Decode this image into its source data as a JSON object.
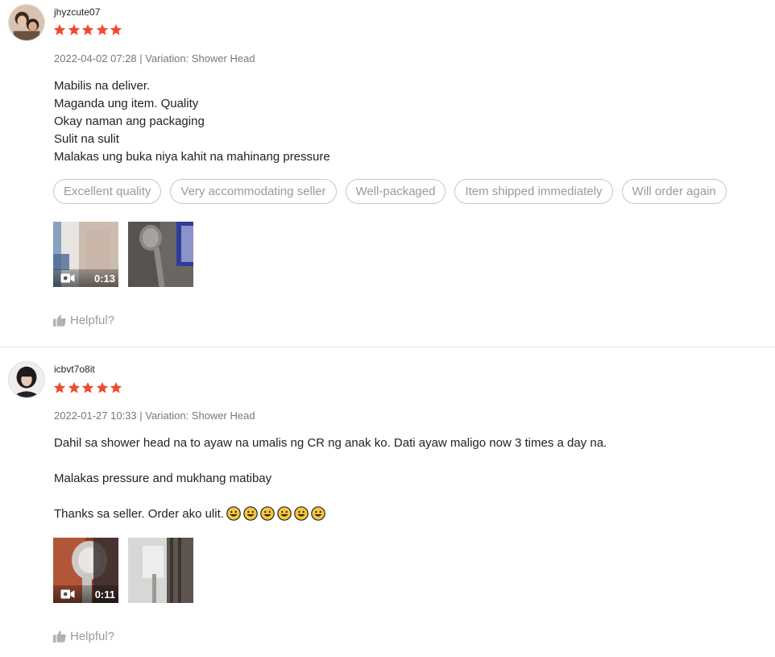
{
  "colors": {
    "star": "#ee4d2d",
    "tag_border": "#c7c7c7",
    "muted_text": "#9a9a9a",
    "divider": "#e8e8e8"
  },
  "reviews": [
    {
      "username": "jhyzcute07",
      "rating": 5,
      "meta": "2022-04-02 07:28 | Variation: Shower Head",
      "comment_lines": [
        "Mabilis na deliver.",
        "Maganda ung item. Quality",
        "Okay naman ang packaging",
        "Sulit na sulit",
        "Malakas ung buka niya kahit na mahinang pressure"
      ],
      "tags": [
        "Excellent quality",
        "Very accommodating seller",
        "Well-packaged",
        "Item shipped immediately",
        "Will order again"
      ],
      "media": [
        {
          "type": "video",
          "duration": "0:13",
          "icon": "video-camera-icon"
        },
        {
          "type": "image"
        }
      ],
      "helpful_label": "Helpful?",
      "helpful_icon": "thumbs-up-icon"
    },
    {
      "username": "icbvt7o8it",
      "rating": 5,
      "meta": "2022-01-27 10:33 | Variation: Shower Head",
      "comment_lines": [
        "Dahil sa shower head na to ayaw na umalis ng CR ng anak ko. Dati ayaw maligo now 3 times a day na.",
        "",
        "Malakas pressure and mukhang matibay",
        "",
        "Thanks sa seller. Order ako ulit."
      ],
      "emoji_count": 6,
      "emoji_icon": "grinning-face-icon",
      "media": [
        {
          "type": "video",
          "duration": "0:11",
          "icon": "video-camera-icon"
        },
        {
          "type": "image"
        }
      ],
      "helpful_label": "Helpful?",
      "helpful_icon": "thumbs-up-icon"
    }
  ]
}
